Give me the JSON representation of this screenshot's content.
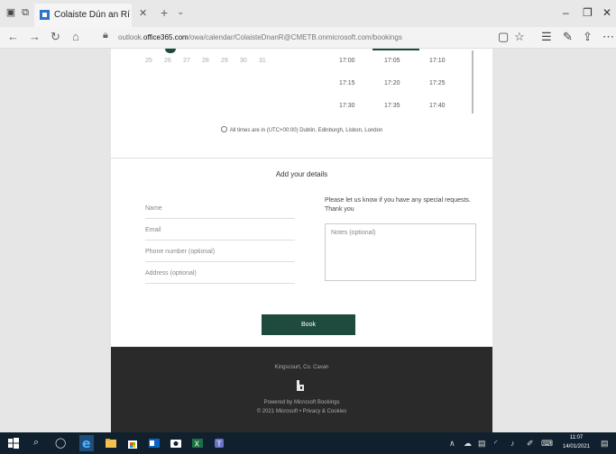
{
  "browser": {
    "tab_title": "Colaiste Dún an Rí",
    "url_prefix": "outlook.",
    "url_domain": "office365.com",
    "url_path": "/owa/calendar/ColaisteDnanR@CMETB.onmicrosoft.com/bookings"
  },
  "calendar": {
    "days": [
      "25",
      "26",
      "27",
      "28",
      "29",
      "30",
      "31"
    ],
    "time_rows": [
      [
        "17:00",
        "17:05",
        "17:10"
      ],
      [
        "17:15",
        "17:20",
        "17:25"
      ],
      [
        "17:30",
        "17:35",
        "17:40"
      ]
    ],
    "timezone_note": "All times are in (UTC+00:00) Dublin, Edinburgh, Lisbon, London"
  },
  "details": {
    "title": "Add your details",
    "name_placeholder": "Name",
    "email_placeholder": "Email",
    "phone_placeholder": "Phone number (optional)",
    "address_placeholder": "Address (optional)",
    "special_requests": "Please let us know if you have any special requests. Thank you",
    "notes_placeholder": "Notes (optional)",
    "book_label": "Book"
  },
  "footer": {
    "location": "Kingscourt, Co. Cavan",
    "powered_by": "Powered by Microsoft Bookings",
    "copyright": "© 2021 Microsoft • Privacy & Cookies"
  },
  "taskbar": {
    "time": "11:07",
    "date": "14/01/2021"
  },
  "colors": {
    "accent_green": "#1e4b3d",
    "footer_dark": "#2a2a2a",
    "taskbar": "#10202e"
  }
}
